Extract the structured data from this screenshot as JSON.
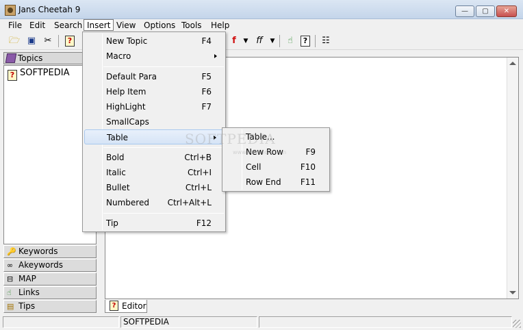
{
  "window": {
    "title": "Jans Cheetah 9",
    "minimize": "—",
    "maximize": "▢",
    "close": "✕"
  },
  "menubar": [
    "File",
    "Edit",
    "Search",
    "Insert",
    "View",
    "Options",
    "Tools",
    "Help"
  ],
  "toolbar": {
    "icons": [
      "open-icon",
      "save-icon",
      "cut-icon",
      "help-topic-icon",
      "font-color-icon",
      "font-icon",
      "hand-icon",
      "help-icon",
      "properties-icon"
    ]
  },
  "topics_panel": {
    "header": "Topics",
    "items": [
      "SOFTPEDIA"
    ]
  },
  "nav_buttons": [
    "Keywords",
    "Akeywords",
    "MAP",
    "Links",
    "Tips"
  ],
  "editor": {
    "tab": "Editor",
    "watermark": "SOFTPEDIA",
    "watermark_url": "www.softpedia.com"
  },
  "statusbar": {
    "cells": [
      "",
      "SOFTPEDIA",
      ""
    ]
  },
  "insert_menu": {
    "items": [
      {
        "label": "New Topic",
        "shortcut": "F4"
      },
      {
        "label": "Macro",
        "shortcut": "",
        "submenu": true
      },
      {
        "label": "Default Para",
        "shortcut": "F5"
      },
      {
        "label": "Help Item",
        "shortcut": "F6"
      },
      {
        "label": "HighLight",
        "shortcut": "F7"
      },
      {
        "label": "SmallCaps",
        "shortcut": ""
      },
      {
        "label": "Table",
        "shortcut": "",
        "submenu": true
      },
      {
        "label": "Bold",
        "shortcut": "Ctrl+B"
      },
      {
        "label": "Italic",
        "shortcut": "Ctrl+I"
      },
      {
        "label": "Bullet",
        "shortcut": "Ctrl+L"
      },
      {
        "label": "Numbered",
        "shortcut": "Ctrl+Alt+L"
      },
      {
        "label": "Tip",
        "shortcut": "F12"
      }
    ]
  },
  "table_submenu": {
    "items": [
      {
        "label": "Table...",
        "shortcut": ""
      },
      {
        "label": "New Row",
        "shortcut": "F9"
      },
      {
        "label": "Cell",
        "shortcut": "F10"
      },
      {
        "label": "Row End",
        "shortcut": "F11"
      }
    ]
  }
}
